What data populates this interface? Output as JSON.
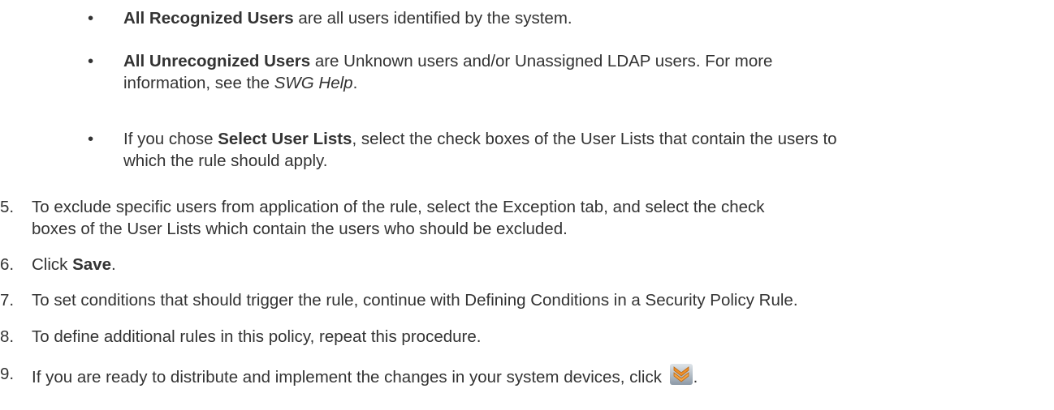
{
  "bullets": [
    {
      "marker": "•",
      "bold": "All Recognized Users",
      "rest": " are all users identified by the system."
    },
    {
      "marker": "•",
      "bold": "All Unrecognized Users",
      "rest_line1": " are Unknown users and/or Unassigned LDAP users. For more",
      "rest_line2_pre": "information, see the ",
      "rest_line2_italic": "SWG Help",
      "rest_line2_post": "."
    },
    {
      "marker": "•",
      "pre": "If you chose ",
      "bold": "Select User Lists",
      "rest_line1": ", select the check boxes of the User Lists that contain the users to",
      "rest_line2": "which the rule should apply."
    }
  ],
  "steps": [
    {
      "num": "5.",
      "line1": "To exclude specific users from application of the rule, select the Exception tab, and select the check",
      "line2": "boxes of the User Lists which contain the users who should be excluded."
    },
    {
      "num": "6.",
      "pre": "Click ",
      "bold": "Save",
      "post": "."
    },
    {
      "num": "7.",
      "text": "To set conditions that should trigger the rule, continue with Defining Conditions in a Security Policy Rule."
    },
    {
      "num": "8.",
      "text": "To define additional rules in this policy, repeat this procedure."
    },
    {
      "num": "9.",
      "text": "If you are ready to distribute and implement the changes in your system devices, click ",
      "post": ".",
      "icon": "distribute-changes-icon"
    }
  ],
  "colors": {
    "text": "#333333",
    "icon_orange": "#f0902a",
    "icon_bg": "#9aa7b4"
  }
}
